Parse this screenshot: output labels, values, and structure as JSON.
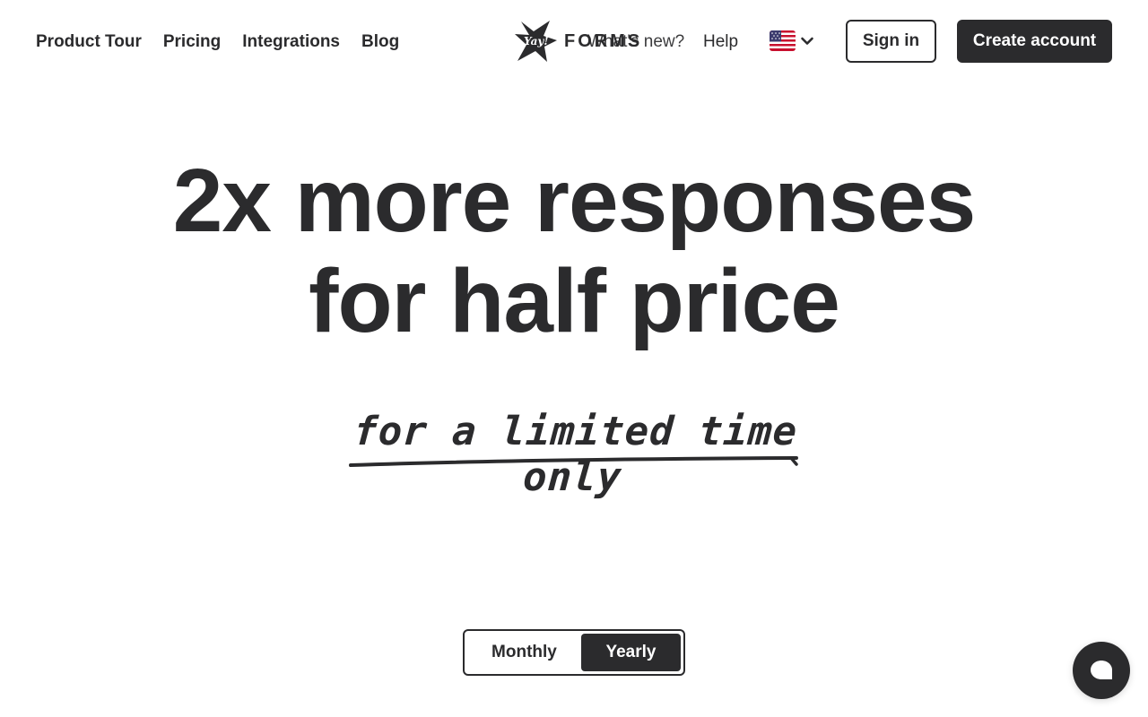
{
  "nav": {
    "links": [
      "Product Tour",
      "Pricing",
      "Integrations",
      "Blog"
    ],
    "whats_new": "What's new?",
    "help": "Help",
    "sign_in": "Sign in",
    "create_account": "Create account"
  },
  "logo": {
    "mark_text": "Yay!",
    "word": "FORMS"
  },
  "language": {
    "selected": "us-flag-icon"
  },
  "hero": {
    "title_line1": "2x more responses",
    "title_line2": "for half price",
    "tagline": "for a limited time only"
  },
  "billing_toggle": {
    "options": [
      "Monthly",
      "Yearly"
    ],
    "selected": "Yearly"
  },
  "chat": {
    "icon": "chat-bubble-icon"
  },
  "colors": {
    "ink": "#2b2b2d",
    "background": "#ffffff"
  }
}
